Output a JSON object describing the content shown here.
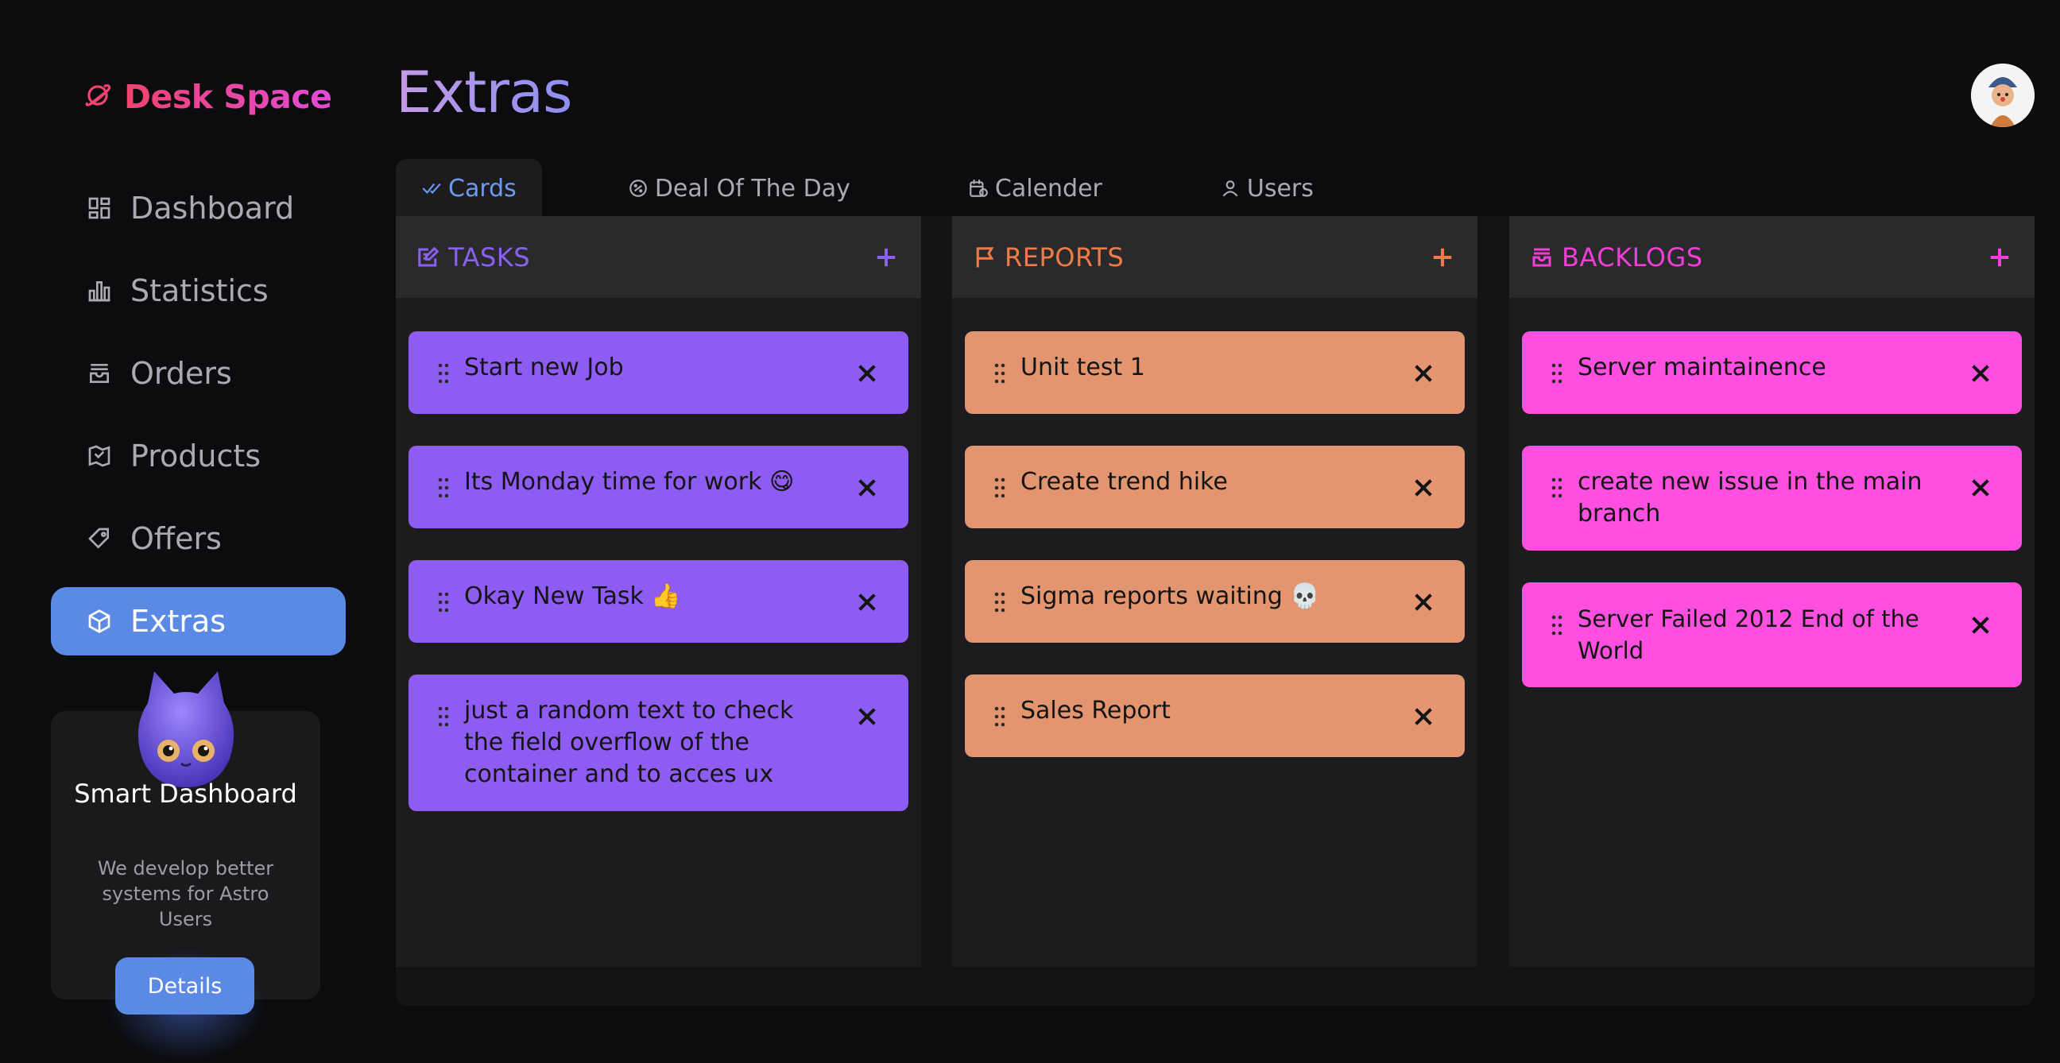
{
  "app": {
    "brand": "Desk Space"
  },
  "sidebar": {
    "items": [
      {
        "label": "Dashboard",
        "icon": "dashboard-icon"
      },
      {
        "label": "Statistics",
        "icon": "bar-chart-icon"
      },
      {
        "label": "Orders",
        "icon": "inbox-icon"
      },
      {
        "label": "Products",
        "icon": "map-icon"
      },
      {
        "label": "Offers",
        "icon": "tag-icon"
      },
      {
        "label": "Extras",
        "icon": "cube-icon",
        "active": true
      }
    ],
    "promo": {
      "title": "Smart Dashboard",
      "text": "We develop better systems for Astro Users",
      "button": "Details"
    }
  },
  "page": {
    "title": "Extras"
  },
  "tabs": [
    {
      "label": "Cards",
      "icon": "double-check-icon",
      "active": true
    },
    {
      "label": "Deal Of The Day",
      "icon": "badge-icon"
    },
    {
      "label": "Calender",
      "icon": "calendar-icon"
    },
    {
      "label": "Users",
      "icon": "user-icon"
    }
  ],
  "colors": {
    "tasks": "#8e5cf2",
    "tasks_head": "#8a60f0",
    "reports": "#e39570",
    "reports_head": "#ef7c48",
    "backlogs": "#ff4fe0",
    "backlogs_head": "#f03ed6",
    "accent": "#5b8ae6"
  },
  "columns": [
    {
      "title": "TASKS",
      "cards": [
        "Start new Job",
        "Its Monday time for work 😋",
        "Okay New Task 👍",
        "just a random text to check the field overflow of the container and to acces ux"
      ]
    },
    {
      "title": "REPORTS",
      "cards": [
        "Unit test 1",
        "Create trend hike",
        "Sigma reports waiting 💀",
        "Sales Report"
      ]
    },
    {
      "title": "BACKLOGS",
      "cards": [
        "Server maintainence",
        "create new issue in the main branch",
        "Server Failed 2012 End of the World"
      ]
    }
  ]
}
